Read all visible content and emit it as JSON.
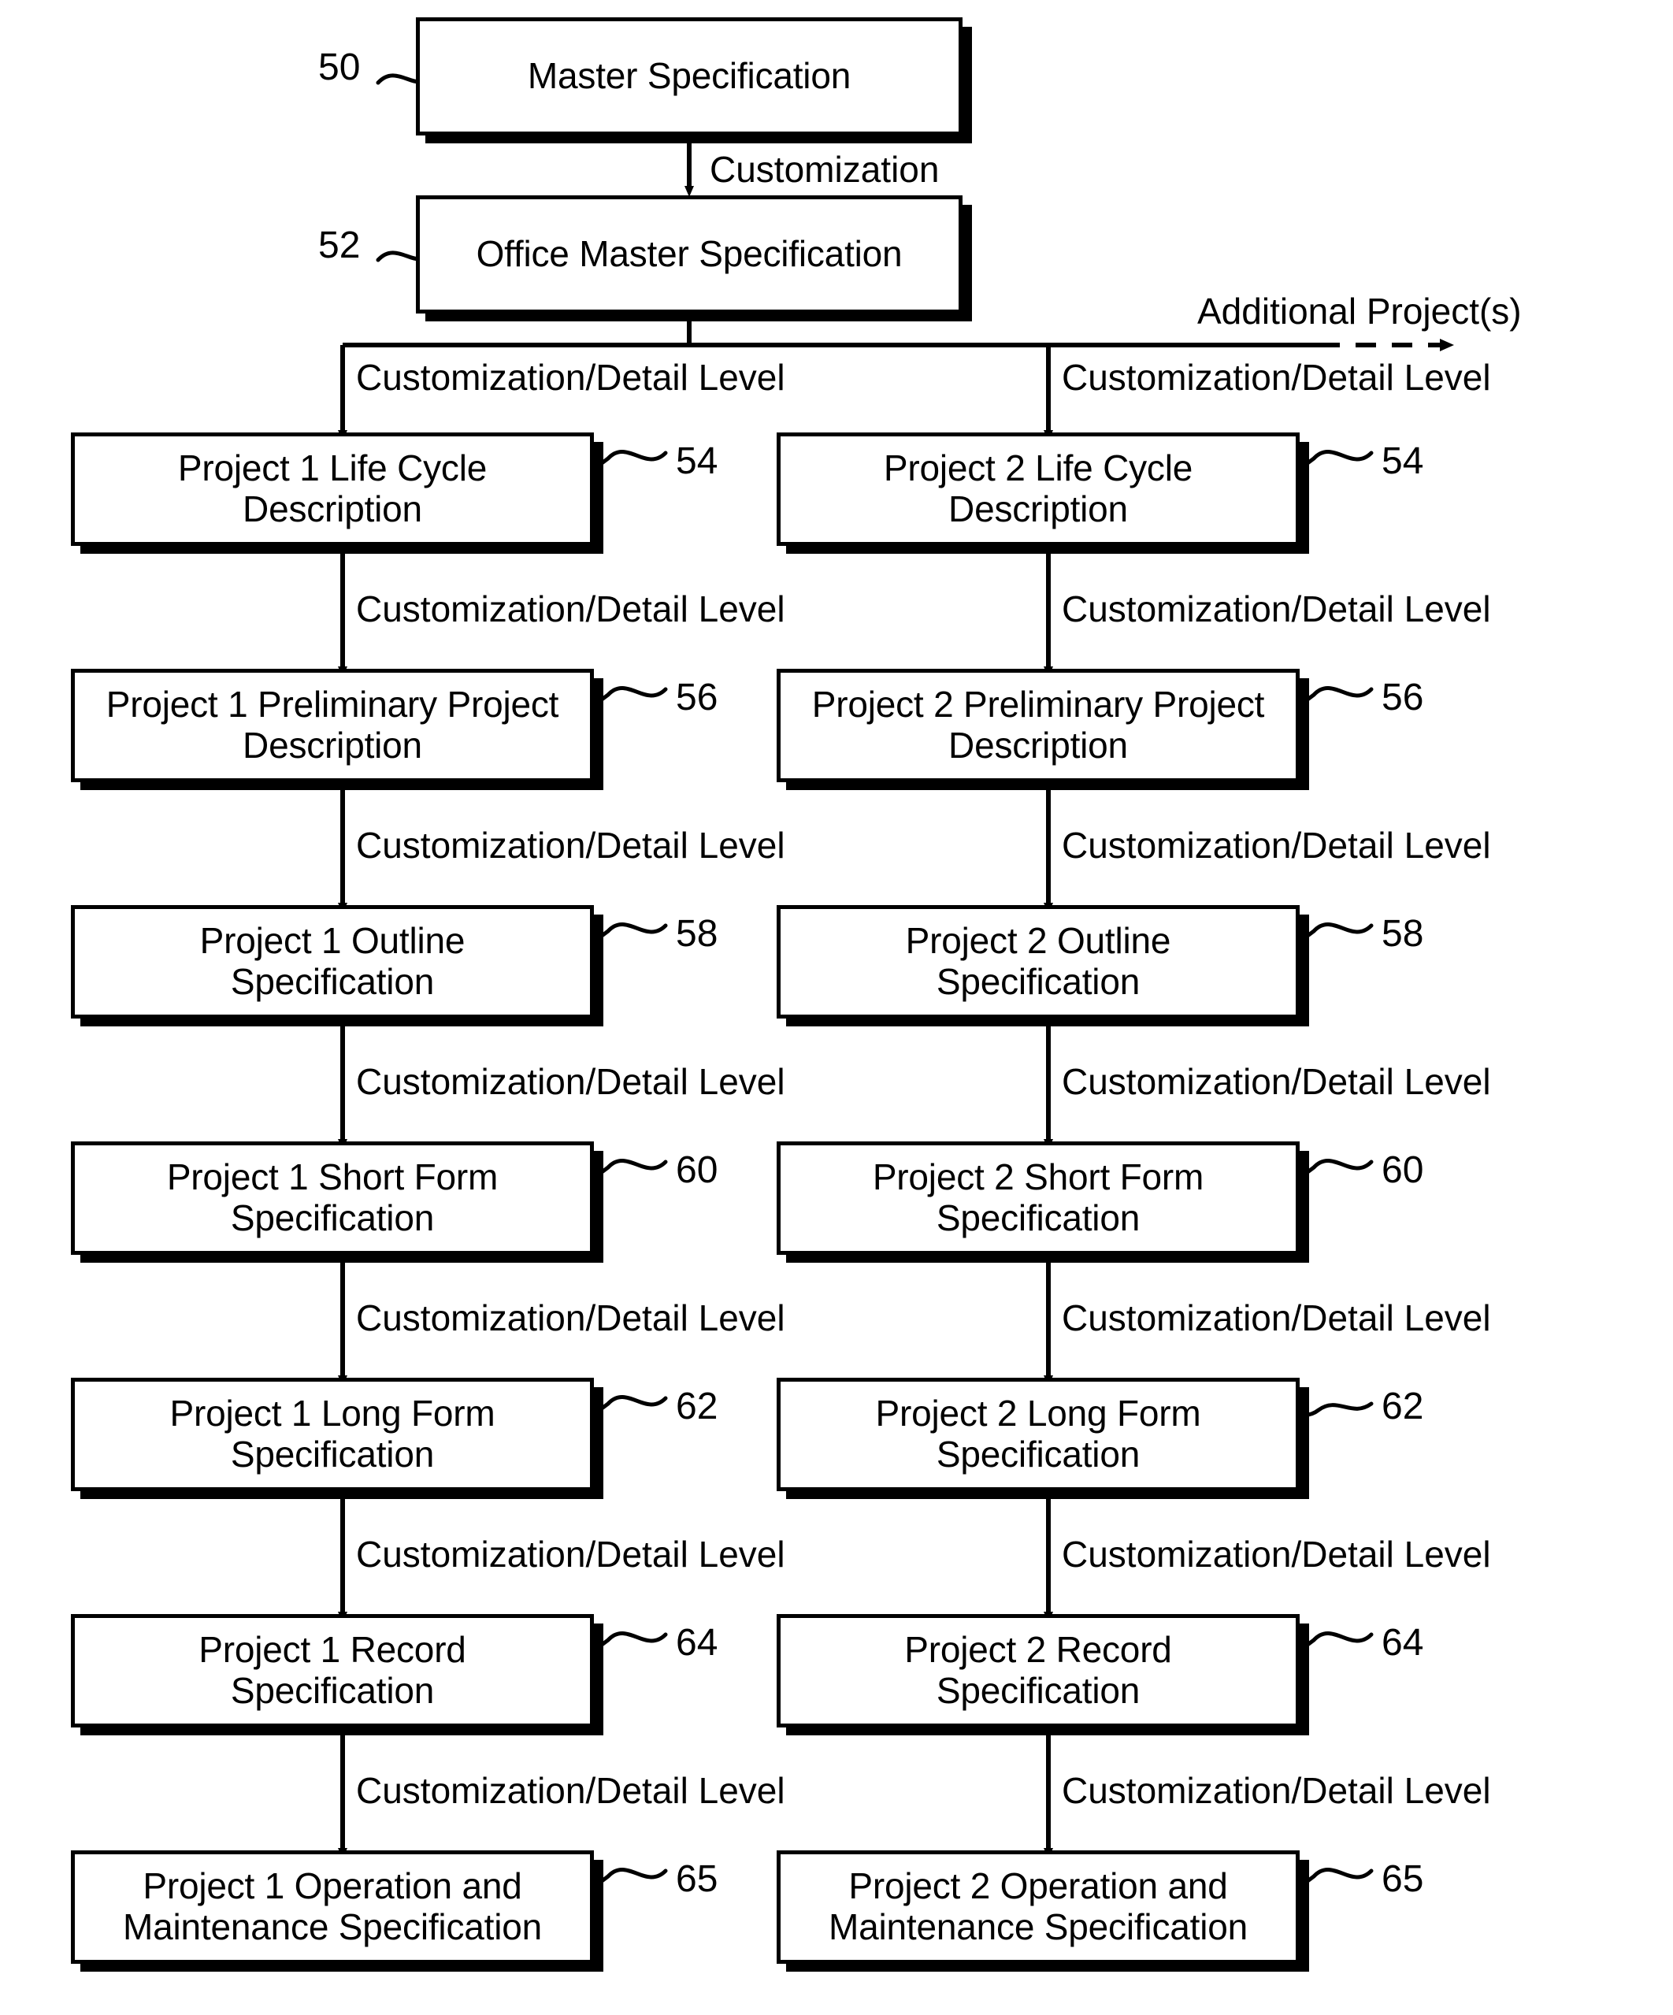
{
  "diagram": {
    "type": "flowchart",
    "orientation": "top-down",
    "columns": [
      "Project 1",
      "Project 2"
    ],
    "nodes": [
      {
        "id": "n50",
        "ref": "50",
        "label": "Master Specification",
        "ref_side": "left"
      },
      {
        "id": "n52",
        "ref": "52",
        "label": "Office Master Specification",
        "ref_side": "left"
      },
      {
        "id": "p1-54",
        "ref": "54",
        "label": "Project 1 Life Cycle\nDescription",
        "ref_side": "right"
      },
      {
        "id": "p2-54",
        "ref": "54",
        "label": "Project 2 Life Cycle\nDescription",
        "ref_side": "right"
      },
      {
        "id": "p1-56",
        "ref": "56",
        "label": "Project 1 Preliminary Project\nDescription",
        "ref_side": "right"
      },
      {
        "id": "p2-56",
        "ref": "56",
        "label": "Project 2 Preliminary Project\nDescription",
        "ref_side": "right"
      },
      {
        "id": "p1-58",
        "ref": "58",
        "label": "Project 1 Outline\nSpecification",
        "ref_side": "right"
      },
      {
        "id": "p2-58",
        "ref": "58",
        "label": "Project 2 Outline\nSpecification",
        "ref_side": "right"
      },
      {
        "id": "p1-60",
        "ref": "60",
        "label": "Project 1 Short Form\nSpecification",
        "ref_side": "right"
      },
      {
        "id": "p2-60",
        "ref": "60",
        "label": "Project 2 Short Form\nSpecification",
        "ref_side": "right"
      },
      {
        "id": "p1-62",
        "ref": "62",
        "label": "Project 1 Long Form\nSpecification",
        "ref_side": "right"
      },
      {
        "id": "p2-62",
        "ref": "62",
        "label": "Project 2 Long Form\nSpecification",
        "ref_side": "right"
      },
      {
        "id": "p1-64",
        "ref": "64",
        "label": "Project 1 Record\nSpecification",
        "ref_side": "right"
      },
      {
        "id": "p2-64",
        "ref": "64",
        "label": "Project 2 Record\nSpecification",
        "ref_side": "right"
      },
      {
        "id": "p1-65",
        "ref": "65",
        "label": "Project 1 Operation and\nMaintenance Specification",
        "ref_side": "right"
      },
      {
        "id": "p2-65",
        "ref": "65",
        "label": "Project 2 Operation and\nMaintenance Specification",
        "ref_side": "right"
      }
    ],
    "edge_labels": {
      "customization": "Customization",
      "customization_detail": "Customization/Detail Level",
      "additional_projects": "Additional Project(s)"
    },
    "edges": [
      {
        "from": "n50",
        "to": "n52",
        "label": "Customization",
        "style": "solid"
      },
      {
        "from": "n52",
        "to": "p1-54",
        "label": "Customization/Detail Level",
        "style": "solid"
      },
      {
        "from": "n52",
        "to": "p2-54",
        "label": "Customization/Detail Level",
        "style": "solid"
      },
      {
        "from": "n52",
        "to": "additional-projects",
        "label": "Additional Project(s)",
        "style": "dashed"
      },
      {
        "from": "p1-54",
        "to": "p1-56",
        "label": "Customization/Detail Level",
        "style": "solid"
      },
      {
        "from": "p2-54",
        "to": "p2-56",
        "label": "Customization/Detail Level",
        "style": "solid"
      },
      {
        "from": "p1-56",
        "to": "p1-58",
        "label": "Customization/Detail Level",
        "style": "solid"
      },
      {
        "from": "p2-56",
        "to": "p2-58",
        "label": "Customization/Detail Level",
        "style": "solid"
      },
      {
        "from": "p1-58",
        "to": "p1-60",
        "label": "Customization/Detail Level",
        "style": "solid"
      },
      {
        "from": "p2-58",
        "to": "p2-60",
        "label": "Customization/Detail Level",
        "style": "solid"
      },
      {
        "from": "p1-60",
        "to": "p1-62",
        "label": "Customization/Detail Level",
        "style": "solid"
      },
      {
        "from": "p2-60",
        "to": "p2-62",
        "label": "Customization/Detail Level",
        "style": "solid"
      },
      {
        "from": "p1-62",
        "to": "p1-64",
        "label": "Customization/Detail Level",
        "style": "solid"
      },
      {
        "from": "p2-62",
        "to": "p2-64",
        "label": "Customization/Detail Level",
        "style": "solid"
      },
      {
        "from": "p1-64",
        "to": "p1-65",
        "label": "Customization/Detail Level",
        "style": "solid"
      },
      {
        "from": "p2-64",
        "to": "p2-65",
        "label": "Customization/Detail Level",
        "style": "solid"
      }
    ],
    "colors": {
      "stroke": "#000000",
      "fill": "#ffffff",
      "text": "#000000"
    }
  }
}
